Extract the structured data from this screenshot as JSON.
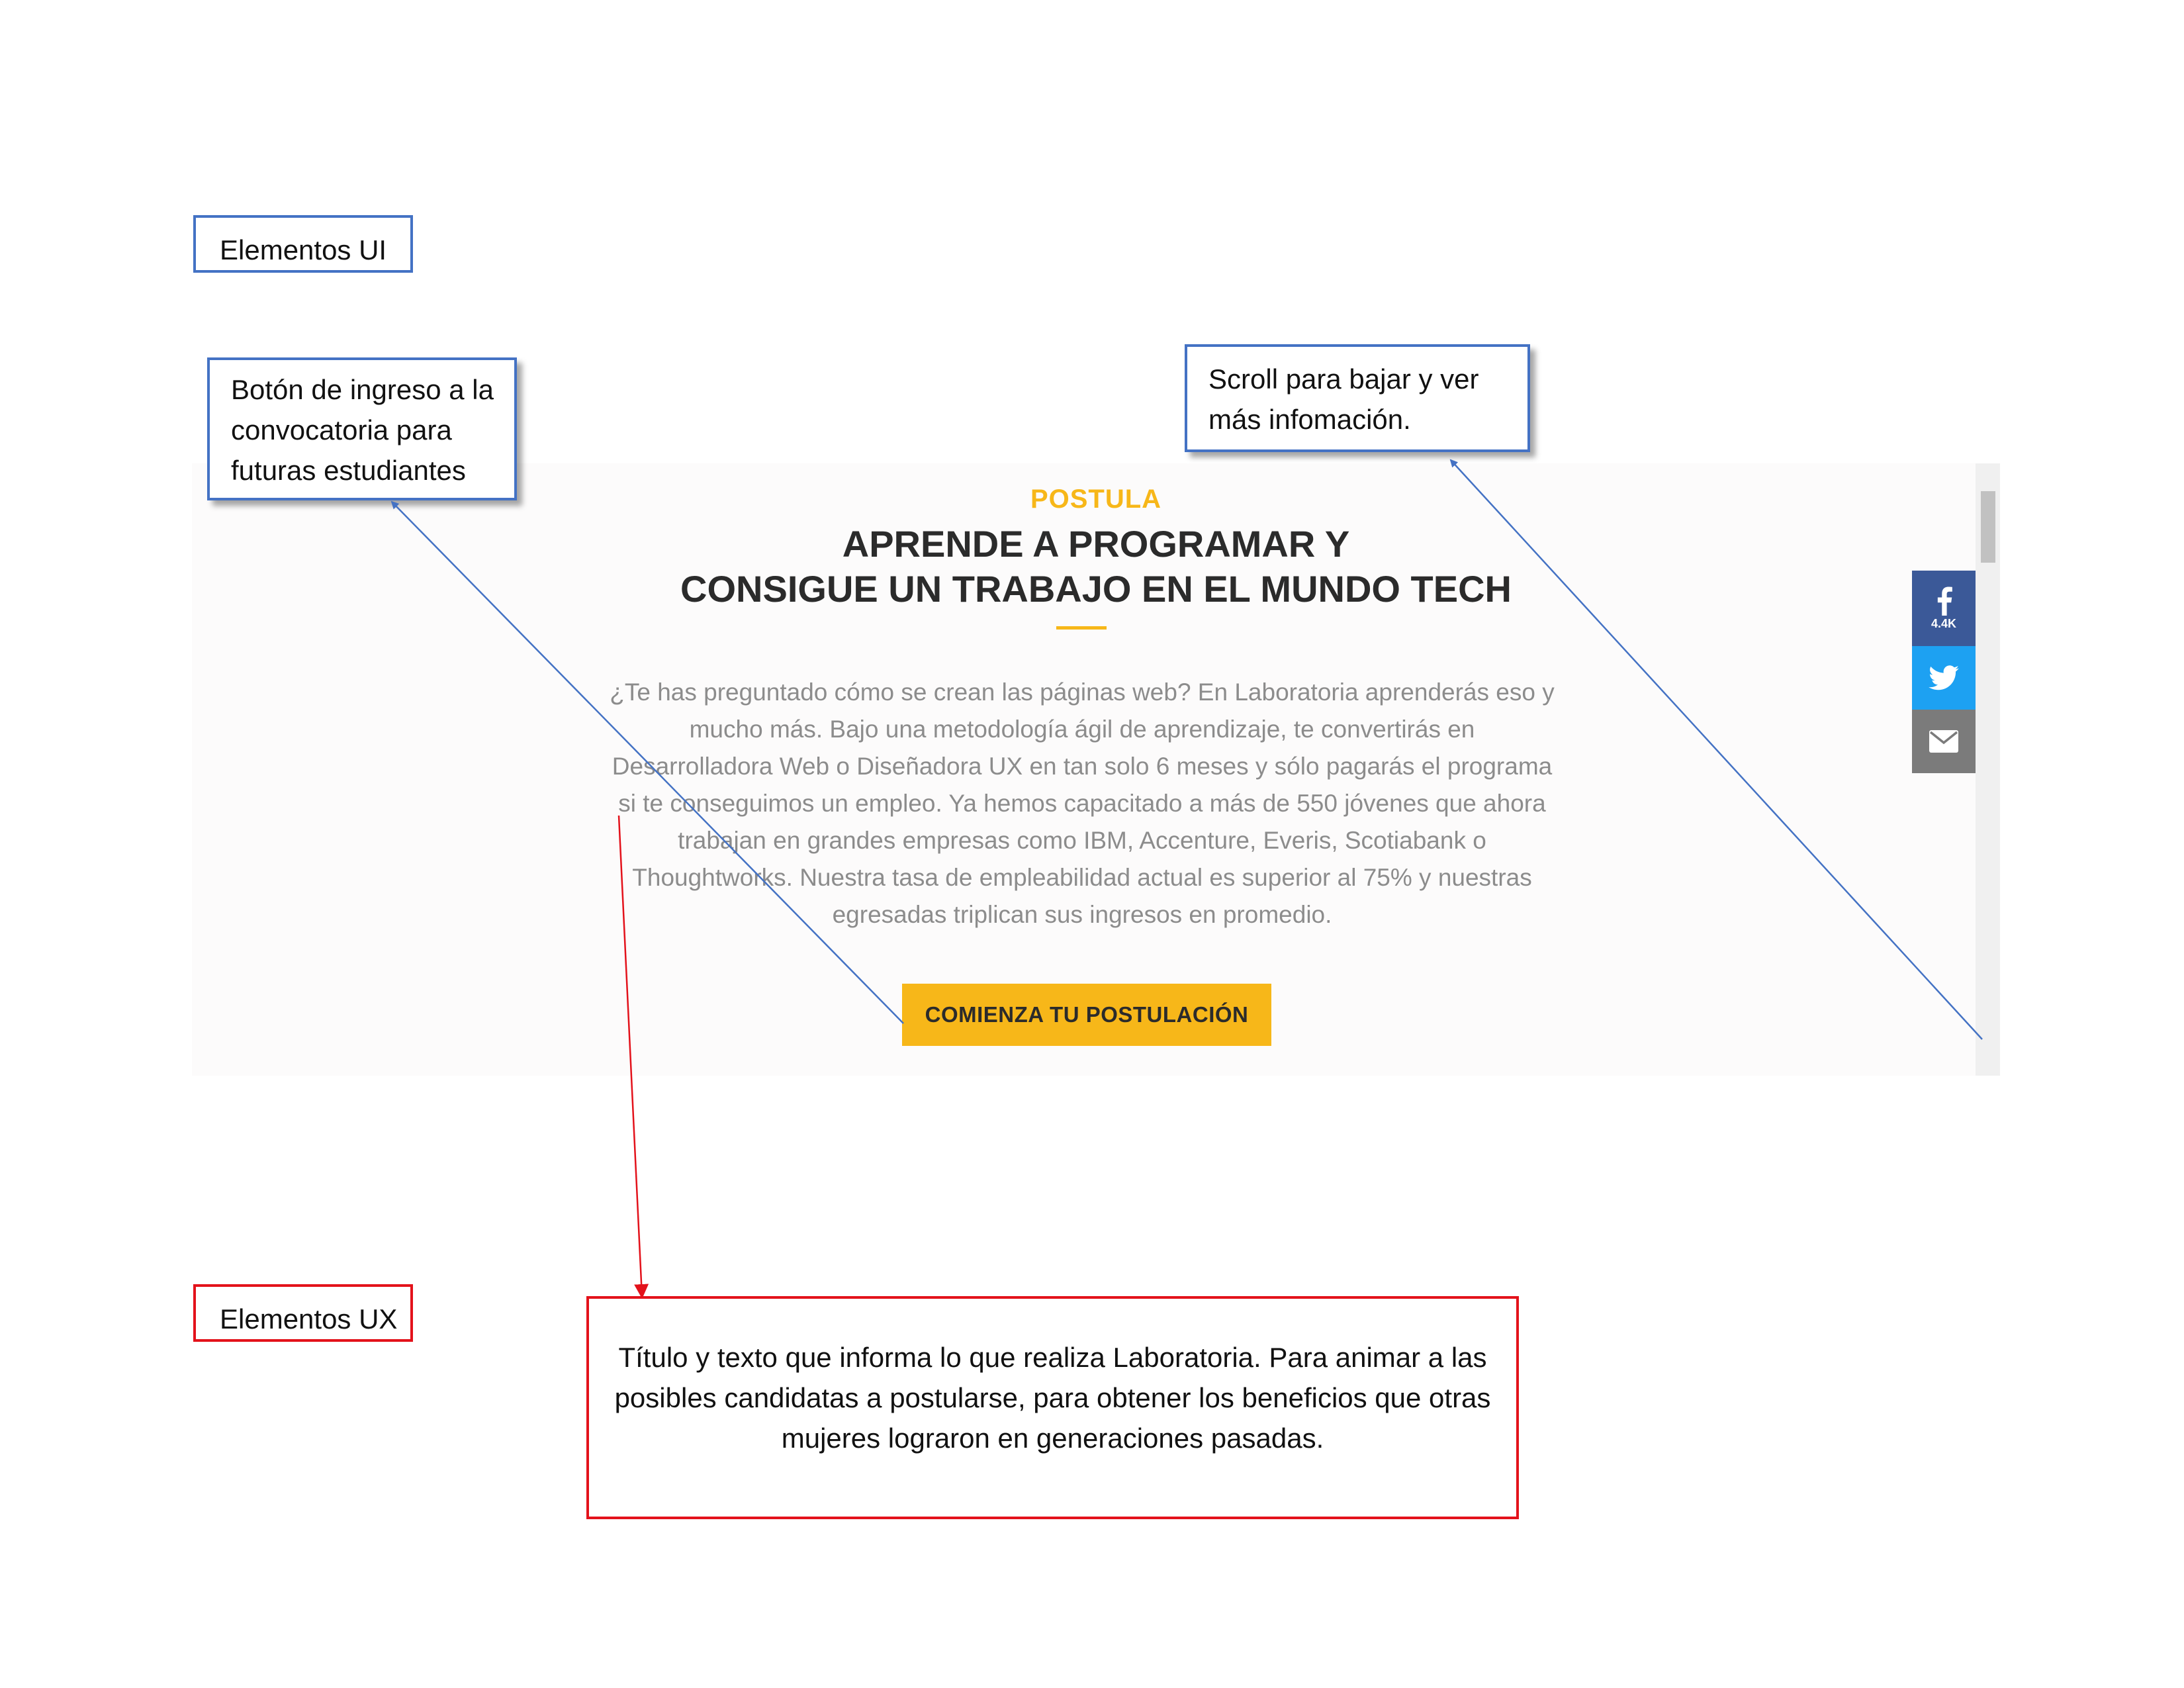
{
  "annotations": {
    "ui_section_label": "Elementos UI",
    "ux_section_label": "Elementos UX",
    "button_callout": [
      "Botón de ingreso a la",
      "convocatoria para",
      "futuras estudiantes"
    ],
    "scroll_callout": [
      "Scroll para bajar y ver",
      "más infomación."
    ],
    "ux_callout": [
      "Título y texto que informa lo que realiza Laboratoria. Para animar a las",
      "posibles candidatas a postularse, para obtener los beneficios que otras",
      "mujeres lograron en generaciones pasadas."
    ],
    "colors": {
      "ui_border": "#4472c4",
      "ux_border": "#e3121b"
    }
  },
  "site": {
    "eyebrow": "POSTULA",
    "headline": [
      "APRENDE A PROGRAMAR Y",
      "CONSIGUE UN TRABAJO EN EL MUNDO TECH"
    ],
    "intro": [
      "¿Te has preguntado cómo se crean las páginas web? En Laboratoria aprenderás eso y",
      "mucho más. Bajo una metodología ágil de aprendizaje, te convertirás en",
      "Desarrolladora Web o Diseñadora UX en tan solo 6 meses y sólo pagarás el programa",
      "si te conseguimos un empleo. Ya hemos capacitado a más de 550 jóvenes que ahora",
      "trabajan en grandes empresas como IBM, Accenture, Everis, Scotiabank o",
      "Thoughtworks. Nuestra tasa de empleabilidad actual es superior al 75% y nuestras",
      "egresadas triplican sus ingresos en promedio."
    ],
    "cta_label": "COMIENZA TU POSTULACIÓN",
    "share": {
      "facebook_icon": "facebook-icon",
      "facebook_count": "4.4K",
      "twitter_icon": "twitter-icon",
      "email_icon": "envelope-icon"
    },
    "colors": {
      "accent": "#f7b719",
      "facebook": "#3b5998",
      "twitter": "#1da1f2",
      "email": "#7b7b7b"
    }
  }
}
